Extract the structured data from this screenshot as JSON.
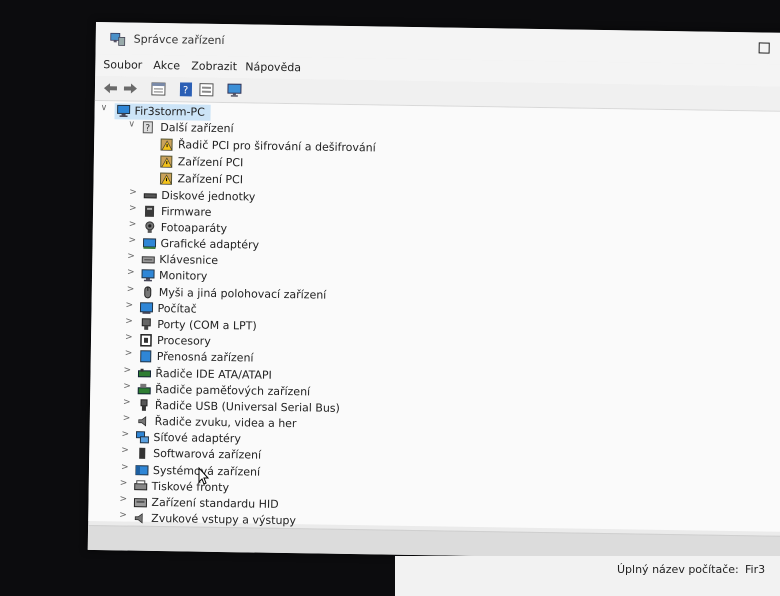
{
  "window": {
    "title": "Správce zařízení"
  },
  "menu": [
    {
      "label": "Soubor"
    },
    {
      "label": "Akce"
    },
    {
      "label": "Zobrazit"
    },
    {
      "label": "Nápověda"
    }
  ],
  "toolbar": {
    "icons": [
      "back-arrow-icon",
      "forward-arrow-icon",
      "properties-icon",
      "help-icon",
      "details-view-icon",
      "monitor-scan-icon"
    ]
  },
  "tree": {
    "root": {
      "label": "Fir3storm-PC",
      "icon": "computer-icon"
    },
    "other_devices": {
      "label": "Další zařízení",
      "icon": "unknown-device-icon",
      "children": [
        {
          "label": "Řadič PCI pro šifrování a dešifrování",
          "icon": "warning-device-icon"
        },
        {
          "label": "Zařízení PCI",
          "icon": "warning-device-icon"
        },
        {
          "label": "Zařízení PCI",
          "icon": "warning-device-icon"
        }
      ]
    },
    "categories": [
      {
        "label": "Diskové jednotky",
        "icon": "disk-drive-icon"
      },
      {
        "label": "Firmware",
        "icon": "firmware-icon"
      },
      {
        "label": "Fotoaparáty",
        "icon": "camera-icon"
      },
      {
        "label": "Grafické adaptéry",
        "icon": "display-adapter-icon"
      },
      {
        "label": "Klávesnice",
        "icon": "keyboard-icon"
      },
      {
        "label": "Monitory",
        "icon": "monitor-icon"
      },
      {
        "label": "Myši a jiná polohovací zařízení",
        "icon": "mouse-icon"
      },
      {
        "label": "Počítač",
        "icon": "computer-icon"
      },
      {
        "label": "Porty (COM a LPT)",
        "icon": "port-icon"
      },
      {
        "label": "Procesory",
        "icon": "processor-icon"
      },
      {
        "label": "Přenosná zařízení",
        "icon": "portable-device-icon"
      },
      {
        "label": "Řadiče IDE ATA/ATAPI",
        "icon": "ide-controller-icon"
      },
      {
        "label": "Řadiče paměťových zařízení",
        "icon": "storage-controller-icon"
      },
      {
        "label": "Řadiče USB (Universal Serial Bus)",
        "icon": "usb-icon"
      },
      {
        "label": "Řadiče zvuku, videa a her",
        "icon": "sound-icon"
      },
      {
        "label": "Síťové adaptéry",
        "icon": "network-adapter-icon"
      },
      {
        "label": "Softwarová zařízení",
        "icon": "software-device-icon"
      },
      {
        "label": "Systémová zařízení",
        "icon": "system-device-icon"
      },
      {
        "label": "Tiskové fronty",
        "icon": "printer-icon"
      },
      {
        "label": "Zařízení standardu HID",
        "icon": "hid-icon"
      },
      {
        "label": "Zvukové vstupy a výstupy",
        "icon": "audio-io-icon"
      }
    ]
  },
  "bottom_panel": {
    "label": "Úplný název počítače:",
    "value": "Fir3"
  },
  "colors": {
    "selection": "#cce4f7",
    "accent_blue": "#1e7fd6",
    "warning_yellow": "#f2c21b"
  }
}
